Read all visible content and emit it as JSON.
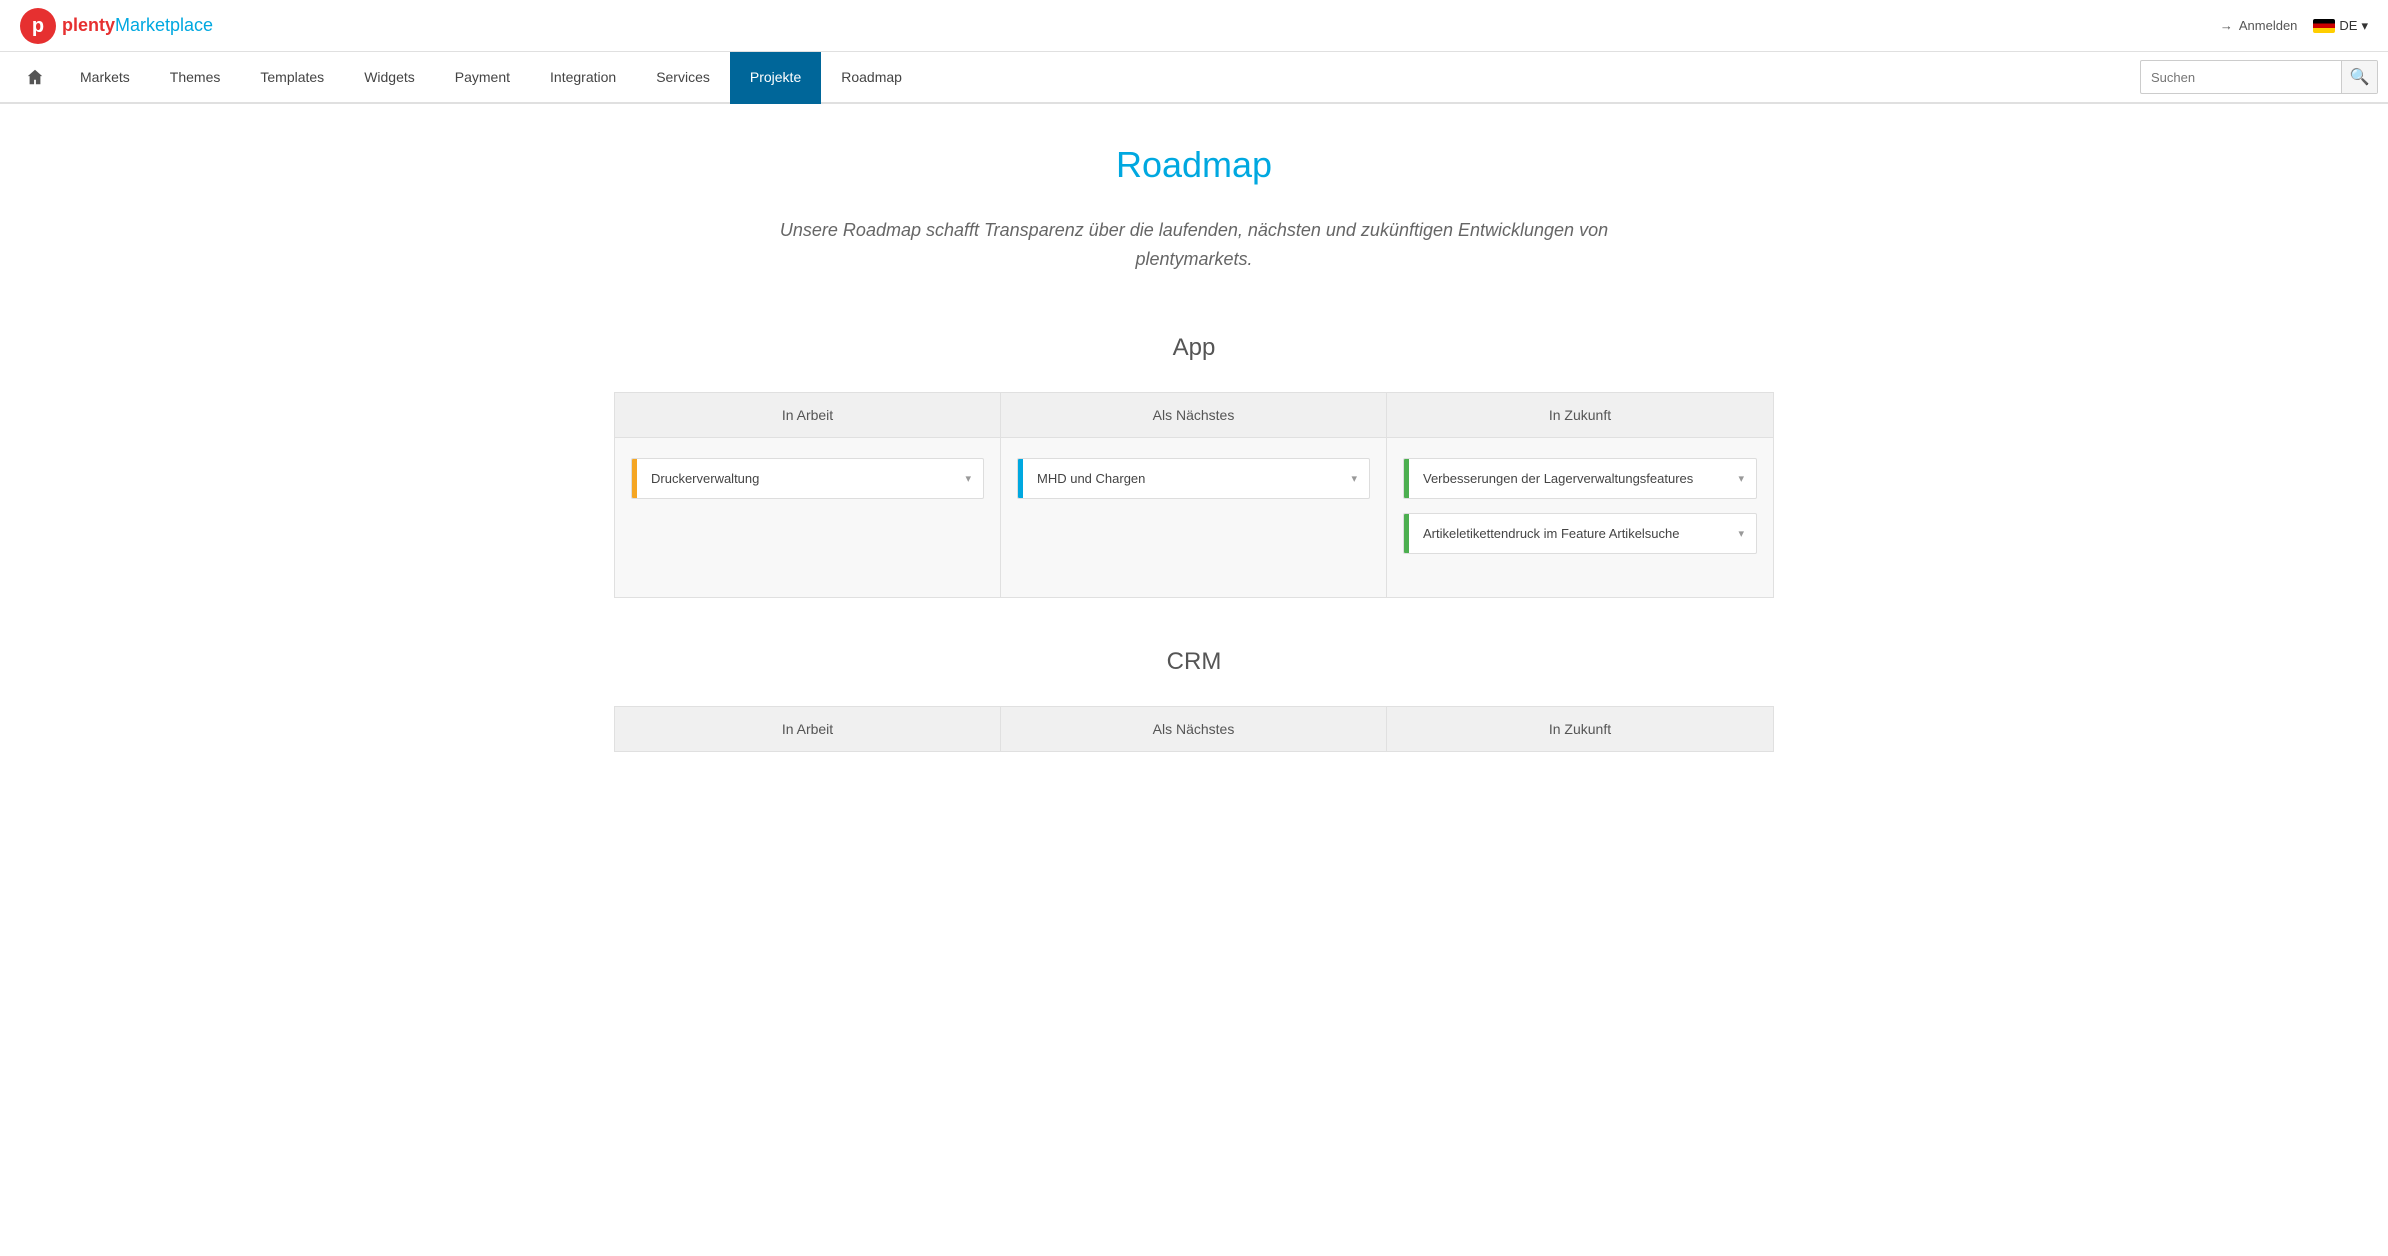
{
  "header": {
    "logo_plenty": "plenty",
    "logo_marketplace": "Marketplace",
    "anmelden_label": "Anmelden",
    "lang_label": "DE",
    "lang_arrow": "▾"
  },
  "nav": {
    "home_label": "Home",
    "items": [
      {
        "id": "markets",
        "label": "Markets",
        "active": false
      },
      {
        "id": "themes",
        "label": "Themes",
        "active": false
      },
      {
        "id": "templates",
        "label": "Templates",
        "active": false
      },
      {
        "id": "widgets",
        "label": "Widgets",
        "active": false
      },
      {
        "id": "payment",
        "label": "Payment",
        "active": false
      },
      {
        "id": "integration",
        "label": "Integration",
        "active": false
      },
      {
        "id": "services",
        "label": "Services",
        "active": false
      },
      {
        "id": "projekte",
        "label": "Projekte",
        "active": true
      },
      {
        "id": "roadmap",
        "label": "Roadmap",
        "active": false
      }
    ],
    "search_placeholder": "Suchen"
  },
  "page": {
    "title": "Roadmap",
    "subtitle": "Unsere Roadmap schafft Transparenz über die laufenden, nächsten und zukünftigen Entwicklungen von plentymarkets."
  },
  "sections": [
    {
      "id": "app",
      "title": "App",
      "columns": [
        {
          "id": "in-arbeit",
          "header": "In Arbeit",
          "items": [
            {
              "label": "Druckerverwaltung",
              "accent": "orange"
            }
          ]
        },
        {
          "id": "als-naechstes",
          "header": "Als Nächstes",
          "items": [
            {
              "label": "MHD und Chargen",
              "accent": "blue"
            }
          ]
        },
        {
          "id": "in-zukunft",
          "header": "In Zukunft",
          "items": [
            {
              "label": "Verbesserungen der Lagerverwaltungsfeatures",
              "accent": "green"
            },
            {
              "label": "Artikeletikettendruck im Feature Artikelsuche",
              "accent": "green"
            }
          ]
        }
      ]
    },
    {
      "id": "crm",
      "title": "CRM",
      "columns": [
        {
          "id": "in-arbeit-crm",
          "header": "In Arbeit",
          "items": []
        },
        {
          "id": "als-naechstes-crm",
          "header": "Als Nächstes",
          "items": []
        },
        {
          "id": "in-zukunft-crm",
          "header": "In Zukunft",
          "items": []
        }
      ]
    }
  ]
}
